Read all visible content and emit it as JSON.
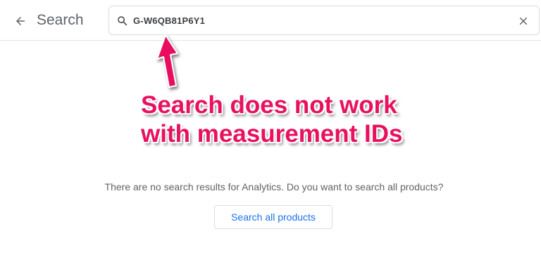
{
  "header": {
    "back_icon": "arrow-back-icon",
    "title": "Search"
  },
  "search": {
    "value": "G-W6QB81P6Y1",
    "search_icon": "search-icon",
    "clear_icon": "close-icon"
  },
  "annotation": {
    "line1": "Search does not work",
    "line2": "with measurement IDs",
    "color": "#e8115f"
  },
  "results": {
    "message": "There are no search results for Analytics. Do you want to search all products?",
    "button_label": "Search all products",
    "button_color": "#1a73e8"
  }
}
